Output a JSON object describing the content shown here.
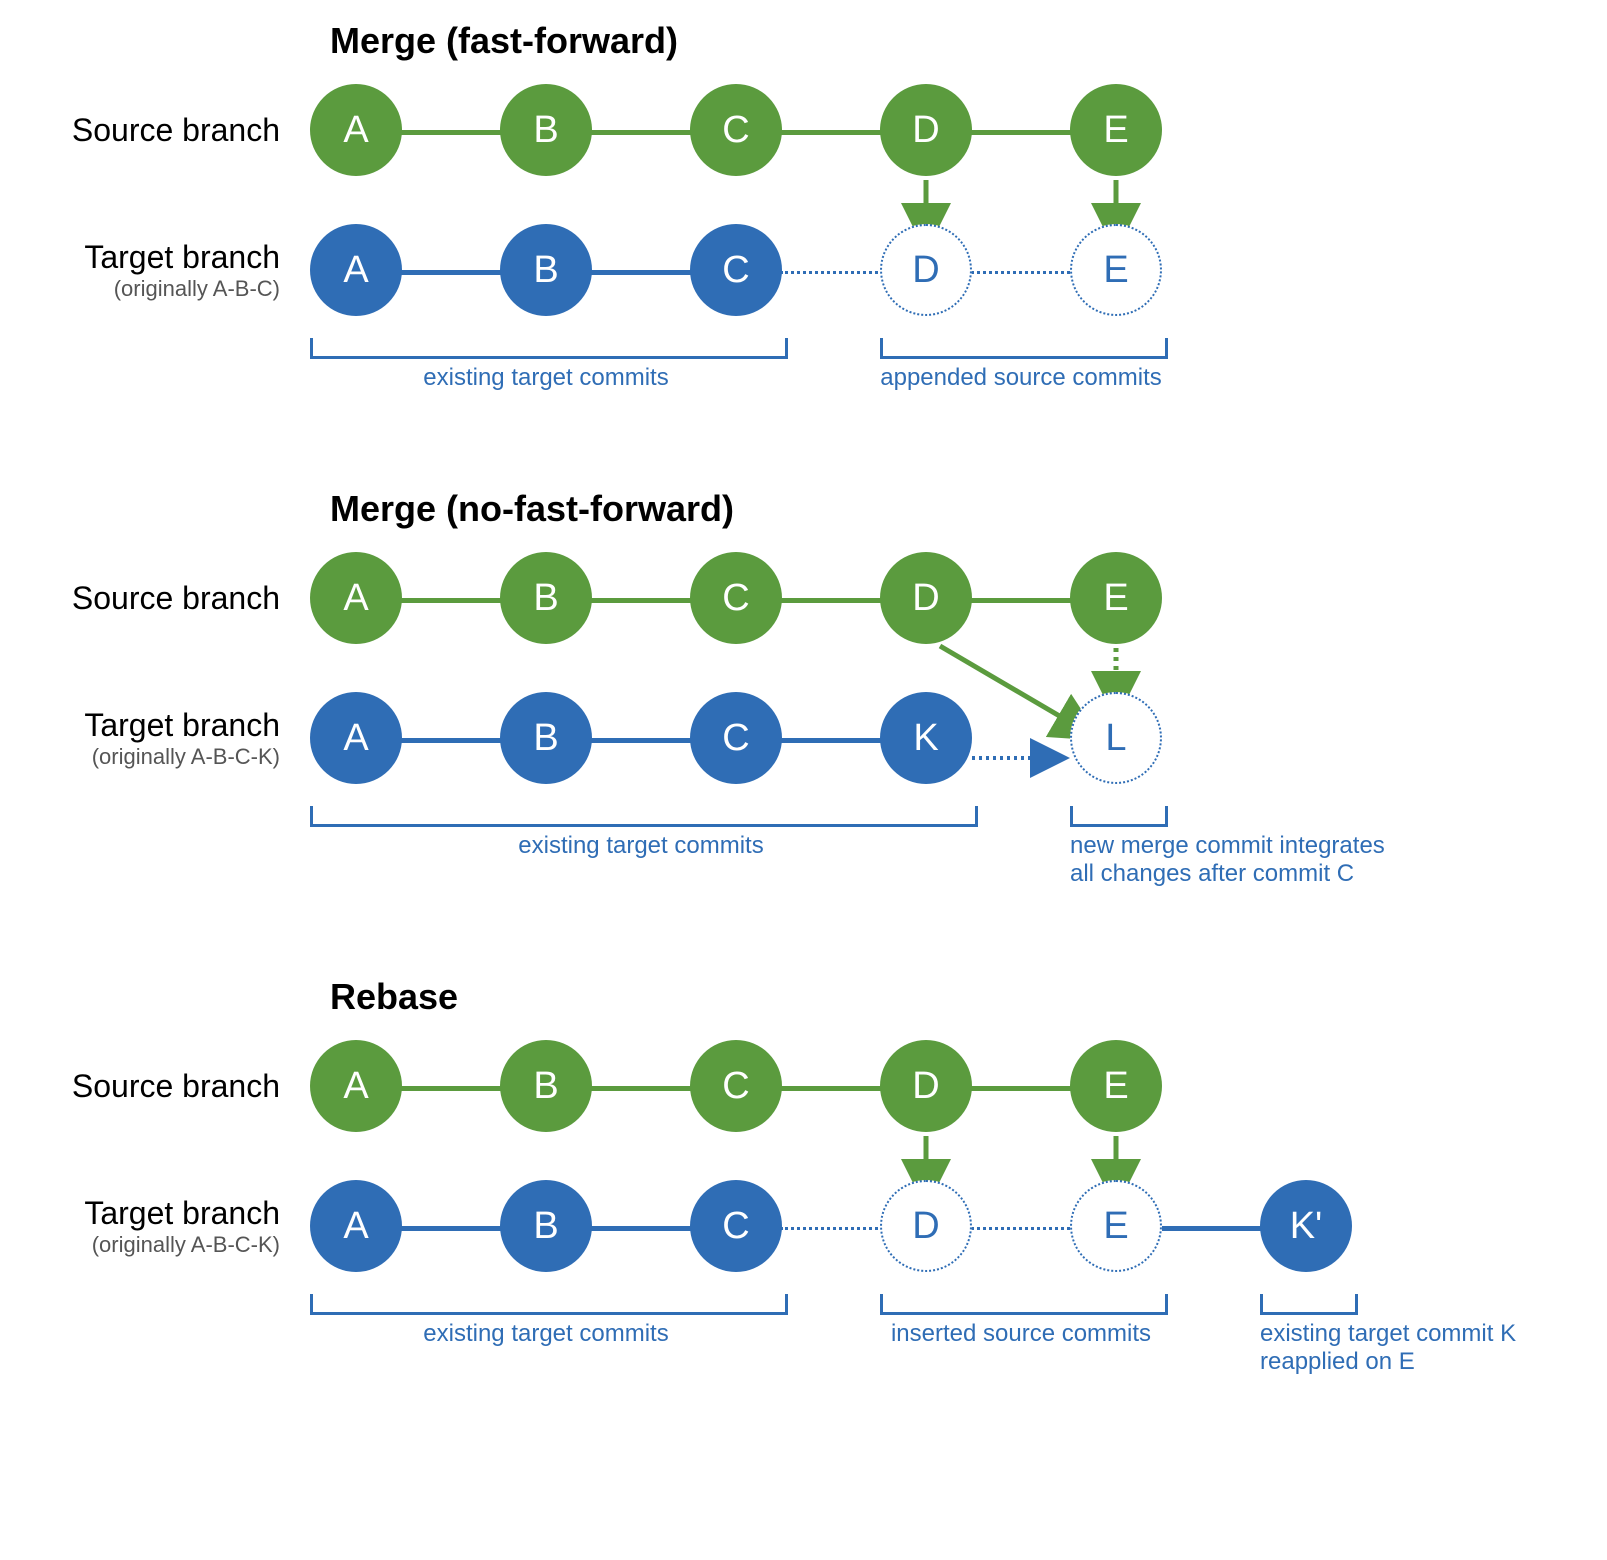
{
  "colors": {
    "green": "#5b9b3e",
    "blue": "#2f6db5"
  },
  "sections": {
    "ff": {
      "title": "Merge (fast-forward)",
      "source_label": "Source branch",
      "target_label": "Target branch",
      "target_sub": "(originally A-B-C)",
      "source": [
        "A",
        "B",
        "C",
        "D",
        "E"
      ],
      "target_solid": [
        "A",
        "B",
        "C"
      ],
      "target_dotted": [
        "D",
        "E"
      ],
      "brackets": {
        "existing": "existing target commits",
        "appended": "appended source commits"
      }
    },
    "noff": {
      "title": "Merge (no-fast-forward)",
      "source_label": "Source branch",
      "target_label": "Target branch",
      "target_sub": "(originally A-B-C-K)",
      "source": [
        "A",
        "B",
        "C",
        "D",
        "E"
      ],
      "target_solid": [
        "A",
        "B",
        "C",
        "K"
      ],
      "target_dotted": [
        "L"
      ],
      "brackets": {
        "existing": "existing target commits",
        "merge": "new merge commit integrates all changes after commit C"
      }
    },
    "rebase": {
      "title": "Rebase",
      "source_label": "Source branch",
      "target_label": "Target branch",
      "target_sub": "(originally A-B-C-K)",
      "source": [
        "A",
        "B",
        "C",
        "D",
        "E"
      ],
      "target_solid": [
        "A",
        "B",
        "C"
      ],
      "target_dotted": [
        "D",
        "E"
      ],
      "target_tail": [
        "K'"
      ],
      "brackets": {
        "existing": "existing target commits",
        "inserted": "inserted source commits",
        "reapplied": "existing target commit K reapplied on E"
      }
    }
  }
}
